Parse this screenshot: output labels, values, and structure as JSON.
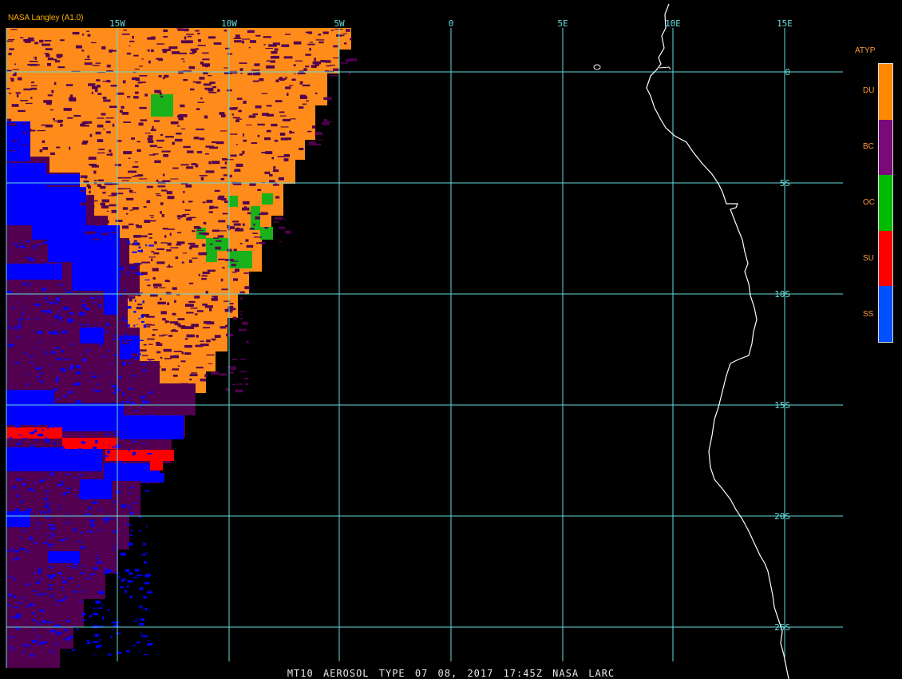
{
  "header": {
    "source_label": "NASA Langley (A1.0)"
  },
  "footer": {
    "caption": "MT10   AEROSOL TYPE   07 08, 2017 17:45Z   NASA LARC"
  },
  "map": {
    "grid_color": "#66dddd",
    "coastline_color": "#ffffff",
    "lon_labels": [
      "15W",
      "10W",
      "5W",
      "0",
      "5E",
      "10E",
      "15E"
    ],
    "lat_labels": [
      "0",
      "5S",
      "10S",
      "15S",
      "20S",
      "25S"
    ]
  },
  "legend": {
    "title": "ATYP",
    "items": [
      {
        "code": "DU",
        "color": "#ff8800"
      },
      {
        "code": "BC",
        "color": "#7a0a7a"
      },
      {
        "code": "OC",
        "color": "#00bb00"
      },
      {
        "code": "SU",
        "color": "#ff0000"
      },
      {
        "code": "SS",
        "color": "#0050ff"
      }
    ]
  },
  "data_colors": {
    "dust_orange": "#ff8c1a",
    "black_carbon_purple": "#52004f",
    "organic_carbon_green": "#1ab21a",
    "sulfate_red": "#ff0000",
    "sea_salt_blue": "#0000ff"
  }
}
